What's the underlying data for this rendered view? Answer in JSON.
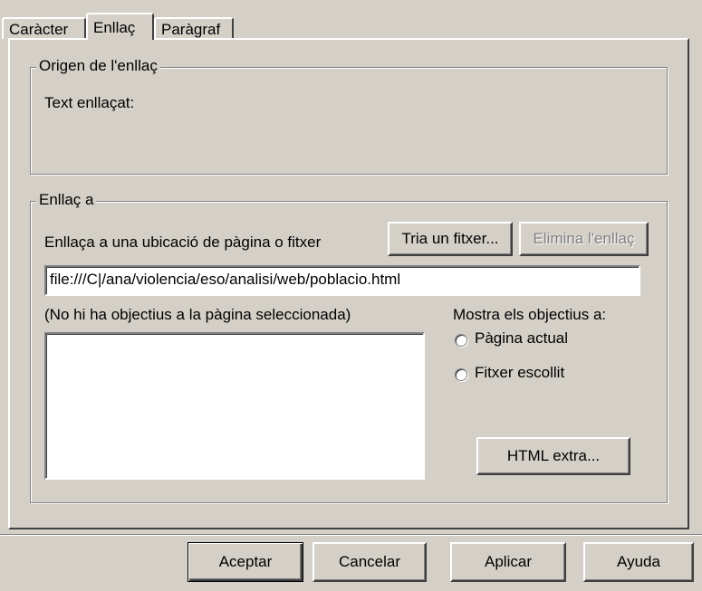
{
  "tabs": [
    {
      "label": "Caràcter"
    },
    {
      "label": "Enllaç"
    },
    {
      "label": "Paràgraf"
    }
  ],
  "link_source": {
    "legend": "Origen de l'enllaç",
    "linked_text_label": "Text enllaçat:"
  },
  "link_to": {
    "legend": "Enllaç a",
    "location_label": "Enllaça a una ubicació de pàgina o fitxer",
    "choose_file_button": "Tria un fitxer...",
    "remove_link_button": "Elimina l'enllaç",
    "url_value": "file:///C|/ana/violencia/eso/analisi/web/poblacio.html",
    "targets_message": "(No hi ha objectius a la pàgina seleccionada)",
    "show_targets_label": "Mostra els objectius a:",
    "radio_current_page": "Pàgina actual",
    "radio_chosen_file": "Fitxer escollit",
    "extra_html_button": "HTML extra..."
  },
  "footer": {
    "accept": "Aceptar",
    "cancel": "Cancelar",
    "apply": "Aplicar",
    "help": "Ayuda"
  }
}
